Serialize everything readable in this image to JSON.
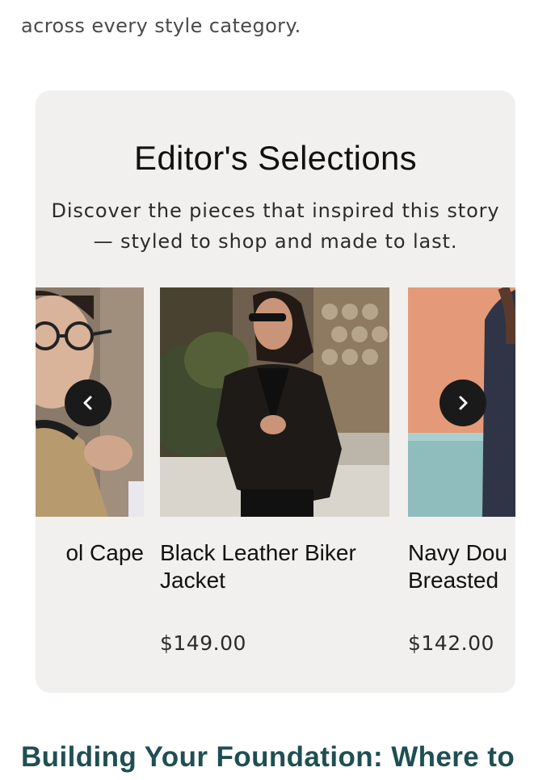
{
  "intro": {
    "text": "across every style category."
  },
  "editors_selections": {
    "title": "Editor's Selections",
    "subtitle_line1": "Discover the pieces that inspired this story",
    "subtitle_line2": "— styled to shop and made to last.",
    "products": [
      {
        "name": "ol Cape",
        "price": ""
      },
      {
        "name_line1": "Black Leather Biker",
        "name_line2": "Jacket",
        "price": "$149.00"
      },
      {
        "name_line1": "Navy Dou",
        "name_line2": "Breasted",
        "price": "$142.00"
      }
    ],
    "nav": {
      "prev_icon": "chevron-left-icon",
      "next_icon": "chevron-right-icon"
    }
  },
  "next_section": {
    "heading": "Building Your Foundation: Where to"
  },
  "colors": {
    "card_bg": "#f1f0ef",
    "heading_teal": "#1f4f52",
    "button_dark": "#1a1a1a"
  }
}
